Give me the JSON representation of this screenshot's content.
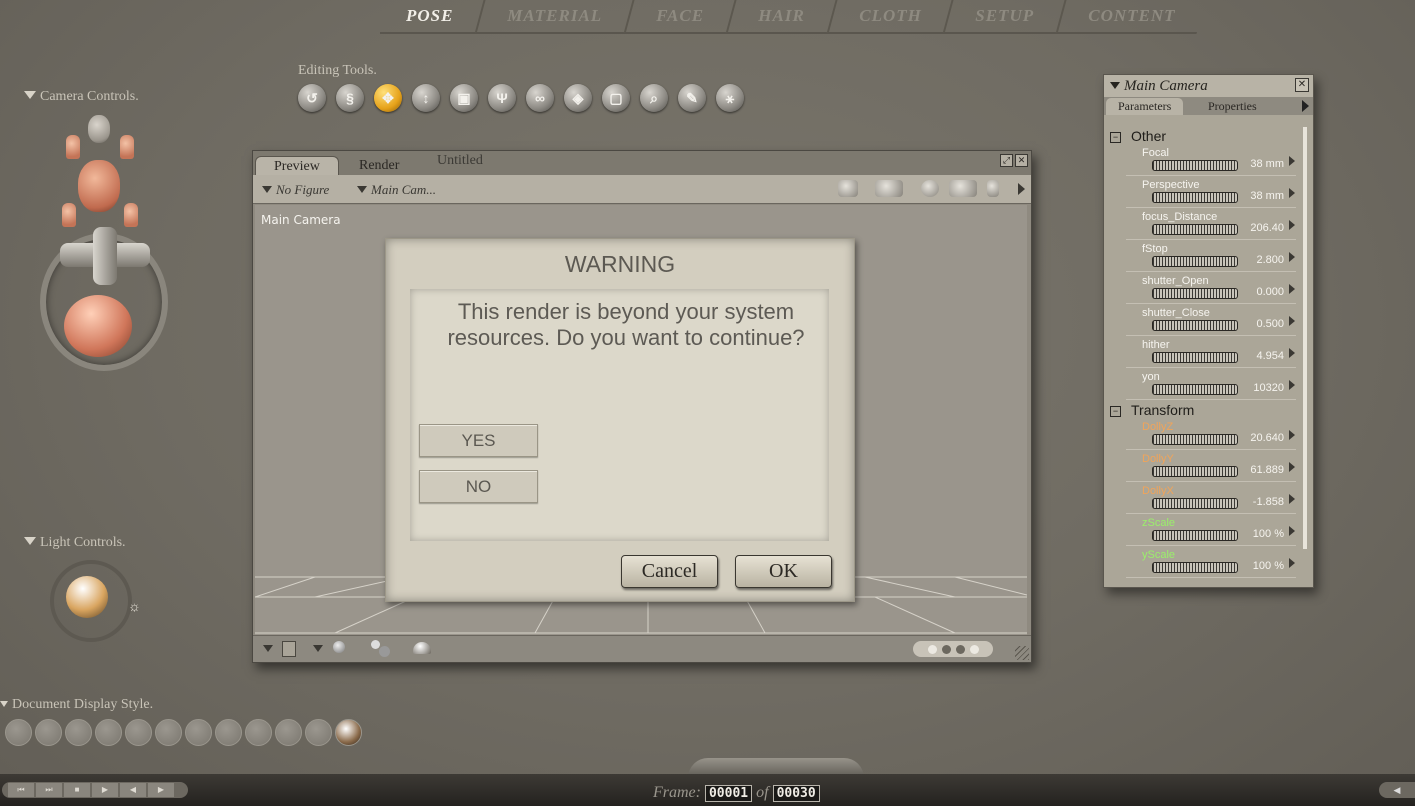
{
  "tabs": [
    "POSE",
    "MATERIAL",
    "FACE",
    "HAIR",
    "CLOTH",
    "SETUP",
    "CONTENT"
  ],
  "active_tab": "POSE",
  "editing_tools": {
    "label": "Editing Tools.",
    "icons": [
      "rotate-icon",
      "twist-icon",
      "translate-icon",
      "translate-in-out-icon",
      "scale-icon",
      "taper-icon",
      "chain-break-icon",
      "color-icon",
      "grouping-icon",
      "view-magnifier-icon",
      "morphing-tool-icon",
      "direct-manipulation-icon"
    ]
  },
  "camera_controls": {
    "label": "Camera Controls."
  },
  "light_controls": {
    "label": "Light Controls."
  },
  "document_display": {
    "label": "Document Display Style."
  },
  "doc_window": {
    "tabs": [
      "Preview",
      "Render"
    ],
    "title": "Untitled",
    "figure_menu": "No Figure",
    "camera_menu": "Main Cam...",
    "viewport_label": "Main Camera"
  },
  "dialog": {
    "title": "WARNING",
    "message": "This render is beyond your system resources. Do you want to continue?",
    "yes": "YES",
    "no": "NO",
    "cancel": "Cancel",
    "ok": "OK"
  },
  "param_panel": {
    "title": "Main Camera",
    "tabs": [
      "Parameters",
      "Properties"
    ],
    "groups": [
      {
        "name": "Other",
        "params": [
          {
            "name": "Focal",
            "value": "38 mm",
            "color": "white"
          },
          {
            "name": "Perspective",
            "value": "38 mm",
            "color": "white"
          },
          {
            "name": "focus_Distance",
            "value": "206.40",
            "color": "white"
          },
          {
            "name": "fStop",
            "value": "2.800",
            "color": "white"
          },
          {
            "name": "shutter_Open",
            "value": "0.000",
            "color": "white"
          },
          {
            "name": "shutter_Close",
            "value": "0.500",
            "color": "white"
          },
          {
            "name": "hither",
            "value": "4.954",
            "color": "white"
          },
          {
            "name": "yon",
            "value": "10320",
            "color": "white"
          }
        ]
      },
      {
        "name": "Transform",
        "params": [
          {
            "name": "DollyZ",
            "value": "20.640",
            "color": "orange"
          },
          {
            "name": "DollyY",
            "value": "61.889",
            "color": "orange"
          },
          {
            "name": "DollyX",
            "value": "-1.858",
            "color": "orange"
          },
          {
            "name": "zScale",
            "value": "100 %",
            "color": "green"
          },
          {
            "name": "yScale",
            "value": "100 %",
            "color": "green"
          }
        ]
      }
    ]
  },
  "timeline": {
    "frame_label": "Frame:",
    "current": "00001",
    "of": "of",
    "total": "00030"
  }
}
